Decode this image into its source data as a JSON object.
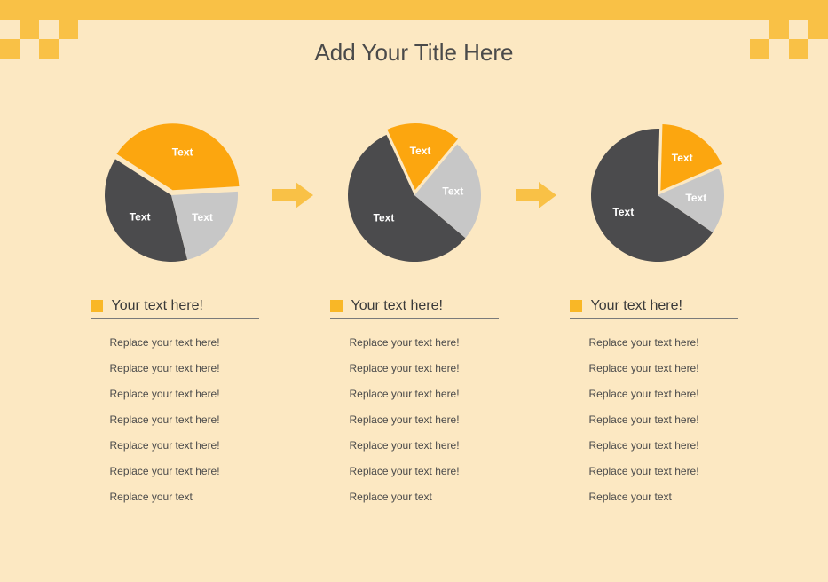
{
  "title": "Add Your Title Here",
  "chart_data": [
    {
      "type": "pie",
      "title": "",
      "slice_label": "Text",
      "slices": [
        {
          "name": "dark",
          "value": 38,
          "color": "#4b4b4d",
          "popout": 0
        },
        {
          "name": "orange",
          "value": 40,
          "color": "#fca60f",
          "popout": 6
        },
        {
          "name": "gray",
          "value": 22,
          "color": "#c7c7c7",
          "popout": 0
        }
      ]
    },
    {
      "type": "pie",
      "title": "",
      "slice_label": "Text",
      "slices": [
        {
          "name": "dark",
          "value": 57,
          "color": "#4b4b4d",
          "popout": 0
        },
        {
          "name": "orange",
          "value": 18,
          "color": "#fca60f",
          "popout": 6
        },
        {
          "name": "gray",
          "value": 25,
          "color": "#c7c7c7",
          "popout": 0
        }
      ]
    },
    {
      "type": "pie",
      "title": "",
      "slice_label": "Text",
      "slices": [
        {
          "name": "dark",
          "value": 66,
          "color": "#4b4b4d",
          "popout": 0
        },
        {
          "name": "orange",
          "value": 18,
          "color": "#fca60f",
          "popout": 6
        },
        {
          "name": "gray",
          "value": 16,
          "color": "#c7c7c7",
          "popout": 0
        }
      ]
    }
  ],
  "start_angles_deg": [
    166,
    130,
    124
  ],
  "arrow_color": "#f9c146",
  "columns": [
    {
      "heading": "Your text here!",
      "items": [
        "Replace your text here!",
        "Replace your text here!",
        "Replace your text here!",
        "Replace your text here!",
        "Replace your text here!",
        "Replace your text here!",
        "Replace your text"
      ]
    },
    {
      "heading": "Your text here!",
      "items": [
        "Replace your text here!",
        "Replace your text here!",
        "Replace your text here!",
        "Replace your text here!",
        "Replace your text here!",
        "Replace your text here!",
        "Replace your text"
      ]
    },
    {
      "heading": "Your text here!",
      "items": [
        "Replace your text here!",
        "Replace your text here!",
        "Replace your text here!",
        "Replace your text here!",
        "Replace your text here!",
        "Replace your text here!",
        "Replace your text"
      ]
    }
  ]
}
